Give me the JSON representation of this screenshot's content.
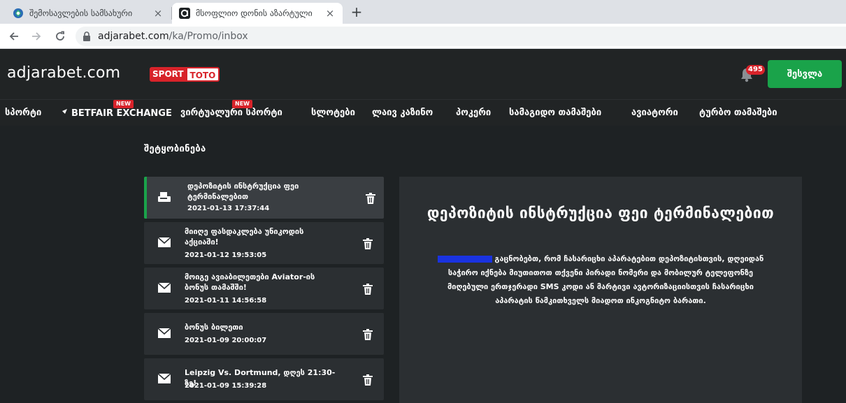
{
  "browser": {
    "tabs": [
      {
        "title": "შემოსავლების სამსახური",
        "close": "×"
      },
      {
        "title": "მსოფლიო დონის აზარტული",
        "close": "×"
      }
    ],
    "new_tab": "+",
    "url_host": "adjarabet.com",
    "url_path": "/ka/Promo/inbox"
  },
  "header": {
    "logo": "adjarabet.com",
    "sporttoto_sport": "SPORT",
    "sporttoto_toto": "TOTO",
    "notification_count": "495",
    "login_label": "შესვლა",
    "accent_color": "#1aa34a",
    "badge_color": "#d8232a"
  },
  "nav": {
    "items": [
      {
        "label": "სპორტი"
      },
      {
        "label": "BETFAIR EXCHANGE",
        "badge": "NEW"
      },
      {
        "label": "ვირტუალური სპორტი",
        "badge": "NEW"
      },
      {
        "label": "სლოტები"
      },
      {
        "label": "ლაივ კაზინო"
      },
      {
        "label": "პოკერი"
      },
      {
        "label": "სამაგიდო თამაშები"
      },
      {
        "label": "ავიატორი"
      },
      {
        "label": "ტურბო თამაშები"
      }
    ]
  },
  "inbox": {
    "title": "შეტყობინება",
    "messages": [
      {
        "title": "დეპოზიტის ინსტრუქცია ფეი ტერმინალებით",
        "date": "2021-01-13 17:37:44",
        "icon": "terminal-icon",
        "active": true
      },
      {
        "title": "მიიღე ფასდაკლება უნიკოდის აქციაში!",
        "date": "2021-01-12 19:53:05",
        "icon": "envelope-icon"
      },
      {
        "title": "მოიგე ავიაბილეთები Aviator-ის ბონუს თამაშში!",
        "date": "2021-01-11 14:56:58",
        "icon": "envelope-icon"
      },
      {
        "title": "ბონუს ბილეთი",
        "date": "2021-01-09 20:00:07",
        "icon": "envelope-icon"
      },
      {
        "title": "Leipzig Vs. Dortmund, დღეს 21:30-ზე!",
        "date": "2021-01-09 15:39:28",
        "icon": "envelope-icon"
      }
    ]
  },
  "detail": {
    "title": "დეპოზიტის ინსტრუქცია ფეი ტერმინალებით",
    "body": "გაცნობებთ, რომ ჩასარიცხი აპარატებით დეპოზიტისთვის, დღეიდან საჭირო იქნება მიუთითოთ თქვენი პირადი ნომერი და მობილურ ტელეფონზე მიღებული ერთჯერადი SMS კოდი ან მარტივი ავტორიზაციისთვის ჩასარიცხი აპარატის წამკითხველს მიადოთ ინკოგნიტო ბარათი."
  }
}
